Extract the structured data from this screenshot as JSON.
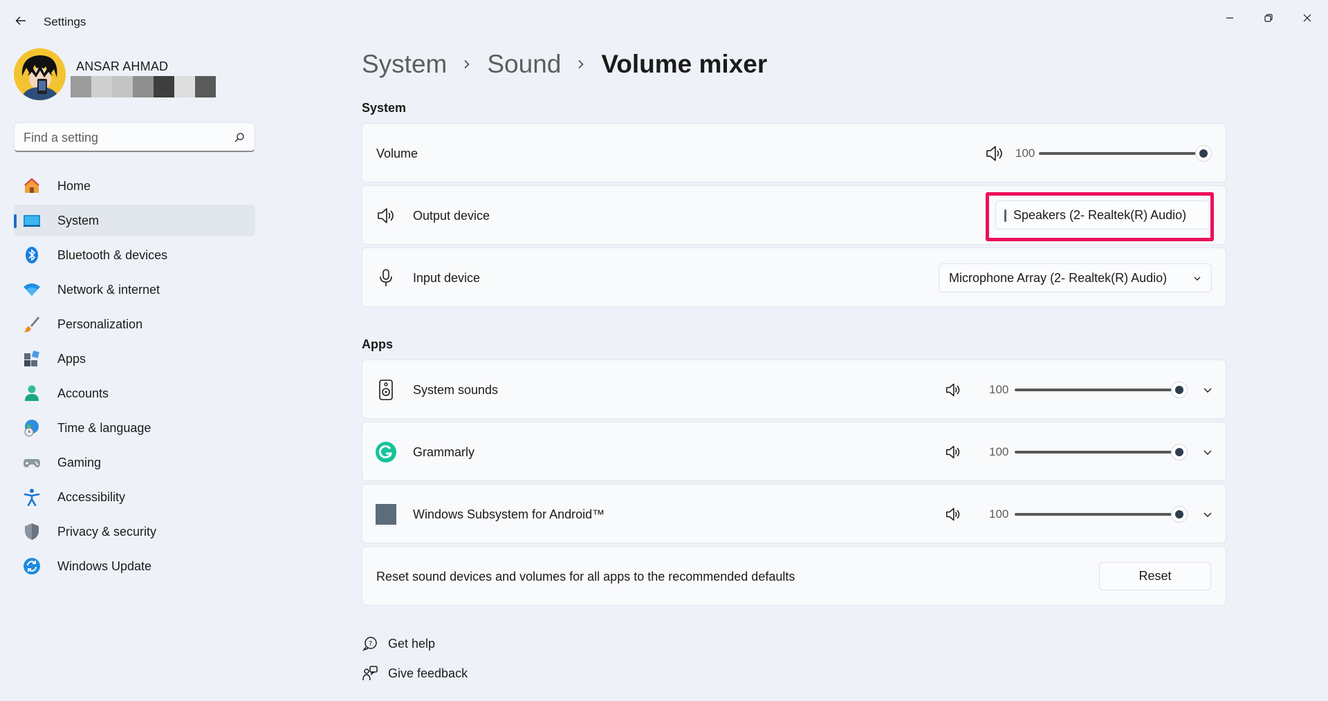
{
  "window": {
    "title": "Settings"
  },
  "profile": {
    "name": "ANSAR AHMAD"
  },
  "search": {
    "placeholder": "Find a setting"
  },
  "nav": {
    "items": [
      {
        "label": "Home"
      },
      {
        "label": "System"
      },
      {
        "label": "Bluetooth & devices"
      },
      {
        "label": "Network & internet"
      },
      {
        "label": "Personalization"
      },
      {
        "label": "Apps"
      },
      {
        "label": "Accounts"
      },
      {
        "label": "Time & language"
      },
      {
        "label": "Gaming"
      },
      {
        "label": "Accessibility"
      },
      {
        "label": "Privacy & security"
      },
      {
        "label": "Windows Update"
      }
    ]
  },
  "breadcrumb": {
    "level1": "System",
    "level2": "Sound",
    "current": "Volume mixer"
  },
  "system_section": {
    "title": "System",
    "volume": {
      "label": "Volume",
      "value": "100",
      "level_percent": 100
    },
    "output": {
      "label": "Output device",
      "selected": "Speakers (2- Realtek(R) Audio)"
    },
    "input": {
      "label": "Input device",
      "selected": "Microphone Array (2- Realtek(R) Audio)"
    }
  },
  "apps_section": {
    "title": "Apps",
    "apps": [
      {
        "name": "System sounds",
        "value": "100",
        "level_percent": 100
      },
      {
        "name": "Grammarly",
        "value": "100",
        "level_percent": 100
      },
      {
        "name": "Windows Subsystem for Android™",
        "value": "100",
        "level_percent": 100
      }
    ],
    "reset": {
      "text": "Reset sound devices and volumes for all apps to the recommended defaults",
      "button": "Reset"
    }
  },
  "footer": {
    "get_help": "Get help",
    "give_feedback": "Give feedback"
  },
  "colors": {
    "accent": "#1d6fc4",
    "highlight": "#ec0f5b",
    "grammarly": "#15c39a"
  }
}
